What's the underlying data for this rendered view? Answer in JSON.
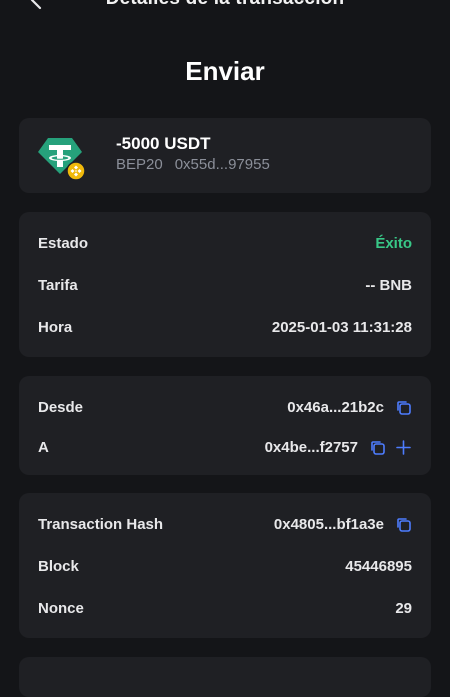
{
  "header": {
    "title": "Detalles de la transacción",
    "back_icon": "chevron-left-icon"
  },
  "page_title": "Enviar",
  "token": {
    "amount": "-5000 USDT",
    "network": "BEP20",
    "address": "0x55d...97955",
    "logo_icon": "tether-icon",
    "badge_icon": "bnb-chain-icon",
    "logo_color": "#26a17b",
    "badge_color": "#f0b90b"
  },
  "status_card": {
    "rows": [
      {
        "label": "Estado",
        "value": "Éxito"
      },
      {
        "label": "Tarifa",
        "value": "-- BNB"
      },
      {
        "label": "Hora",
        "value": "2025-01-03 11:31:28"
      }
    ],
    "success_color": "#38c787"
  },
  "addresses_card": {
    "from_label": "Desde",
    "from_value": "0x46a...21b2c",
    "to_label": "A",
    "to_value": "0x4be...f2757",
    "copy_icon": "copy-icon",
    "add_icon": "plus-icon",
    "accent_color": "#4d7cfe"
  },
  "chain_card": {
    "hash_label": "Transaction Hash",
    "hash_value": "0x4805...bf1a3e",
    "block_label": "Block",
    "block_value": "45446895",
    "nonce_label": "Nonce",
    "nonce_value": "29"
  }
}
